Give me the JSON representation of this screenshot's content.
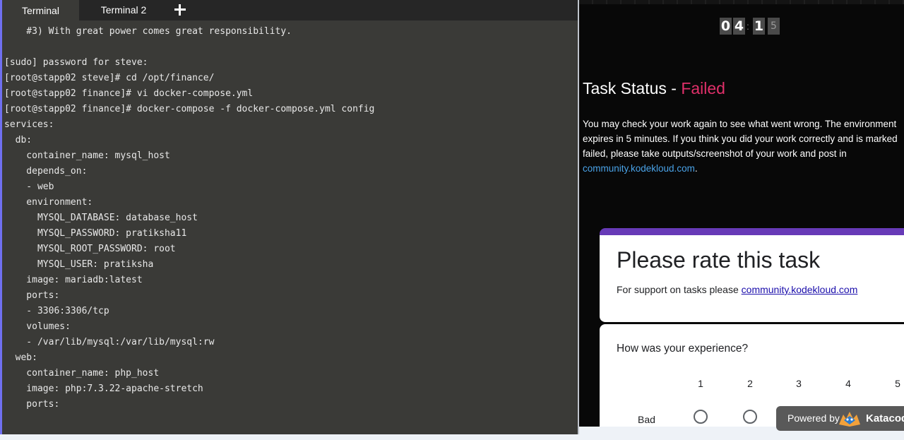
{
  "tabs": [
    {
      "label": "Terminal"
    },
    {
      "label": "Terminal 2"
    }
  ],
  "terminal": {
    "lines": [
      "    #3) With great power comes great responsibility.",
      "",
      "[sudo] password for steve:",
      "[root@stapp02 steve]# cd /opt/finance/",
      "[root@stapp02 finance]# vi docker-compose.yml",
      "[root@stapp02 finance]# docker-compose -f docker-compose.yml config",
      "services:",
      "  db:",
      "    container_name: mysql_host",
      "    depends_on:",
      "    - web",
      "    environment:",
      "      MYSQL_DATABASE: database_host",
      "      MYSQL_PASSWORD: pratiksha11",
      "      MYSQL_ROOT_PASSWORD: root",
      "      MYSQL_USER: pratiksha",
      "    image: mariadb:latest",
      "    ports:",
      "    - 3306:3306/tcp",
      "    volumes:",
      "    - /var/lib/mysql:/var/lib/mysql:rw",
      "  web:",
      "    container_name: php_host",
      "    image: php:7.3.22-apache-stretch",
      "    ports:"
    ]
  },
  "timer": {
    "digits": [
      "0",
      "4",
      "1",
      "5"
    ]
  },
  "task_status": {
    "label": "Task Status - ",
    "value": "Failed",
    "message": "You may check your work again to see what went wrong. The environment expires in 5 minutes. If you think you did your work correctly and is marked failed, please take outputs/screenshot of your work and post in ",
    "link": "community.kodekloud.com",
    "after_link": "."
  },
  "rating_form": {
    "title": "Please rate this task",
    "support_text": "For support on tasks please ",
    "support_link": "community.kodekloud.com",
    "question": "How was your experience?",
    "scale": [
      "1",
      "2",
      "3",
      "4",
      "5"
    ],
    "low_label": "Bad"
  },
  "powered_by": {
    "text": "Powered by",
    "brand": "Katacoda"
  },
  "colors": {
    "failed": "#e0306a",
    "form_accent": "#673ab7",
    "link": "#4aa3e8"
  }
}
